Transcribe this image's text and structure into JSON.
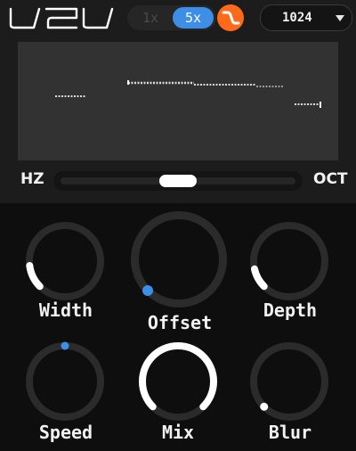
{
  "header": {
    "logo_text": "V2V",
    "oversample": {
      "options": [
        "1x",
        "5x"
      ],
      "selected": "5x"
    },
    "filter_button": {
      "icon": "filter-curve-icon",
      "color": "#ff6a1a"
    },
    "fft_size": {
      "value": "1024"
    }
  },
  "spectrum": {
    "background": "#323232"
  },
  "range_slider": {
    "left_label": "HZ",
    "right_label": "OCT",
    "position": 0.5
  },
  "knobs": [
    {
      "id": "width",
      "label": "Width",
      "value": 0.14,
      "style": "arc"
    },
    {
      "id": "offset",
      "label": "Offset",
      "value": 0.0,
      "style": "dot"
    },
    {
      "id": "depth",
      "label": "Depth",
      "value": 0.12,
      "style": "arc"
    },
    {
      "id": "speed",
      "label": "Speed",
      "value": 0.5,
      "style": "dot"
    },
    {
      "id": "mix",
      "label": "Mix",
      "value": 1.0,
      "style": "arc"
    },
    {
      "id": "blur",
      "label": "Blur",
      "value": 0.0,
      "style": "dot"
    }
  ],
  "colors": {
    "accent": "#3d8ee6",
    "filter": "#ff6a1a",
    "knob_track": "#2b2b2b",
    "knob_fill": "#ffffff"
  }
}
